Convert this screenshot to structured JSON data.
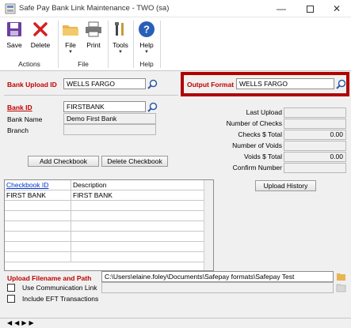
{
  "window": {
    "title": "Safe Pay Bank Link Maintenance  -  TWO (sa)"
  },
  "ribbon": {
    "save": "Save",
    "delete": "Delete",
    "file": "File",
    "print": "Print",
    "tools": "Tools",
    "help": "Help",
    "groups": {
      "actions": "Actions",
      "file": "File",
      "help": "Help"
    }
  },
  "form": {
    "bank_upload_id_label": "Bank Upload ID",
    "bank_upload_id_value": "WELLS FARGO",
    "output_format_label": "Output Format",
    "output_format_value": "WELLS FARGO",
    "bank_id_label": "Bank ID",
    "bank_id_value": "FIRSTBANK",
    "bank_name_label": "Bank Name",
    "bank_name_value": "Demo First Bank",
    "branch_label": "Branch",
    "branch_value": "",
    "add_checkbook": "Add Checkbook",
    "delete_checkbook": "Delete Checkbook"
  },
  "stats": {
    "last_upload_label": "Last Upload",
    "last_upload": "",
    "num_checks_label": "Number of Checks",
    "num_checks": "",
    "checks_total_label": "Checks $ Total",
    "checks_total": "0.00",
    "num_voids_label": "Number of Voids",
    "num_voids": "",
    "voids_total_label": "Voids $ Total",
    "voids_total": "0.00",
    "confirm_label": "Confirm Number",
    "confirm": "",
    "upload_history": "Upload History"
  },
  "grid": {
    "col_checkbook": "Checkbook ID",
    "col_description": "Description",
    "rows": [
      {
        "checkbook": "FIRST BANK",
        "description": "FIRST BANK"
      }
    ]
  },
  "upload": {
    "label": "Upload Filename and Path",
    "path": "C:\\Users\\elaine.foley\\Documents\\Safepay formats\\Safepay Test",
    "use_comm_link": "Use Communication Link",
    "include_eft": "Include EFT Transactions"
  },
  "colors": {
    "accent_red": "#c00000",
    "highlight": "#b00000",
    "link": "#0033cc"
  }
}
